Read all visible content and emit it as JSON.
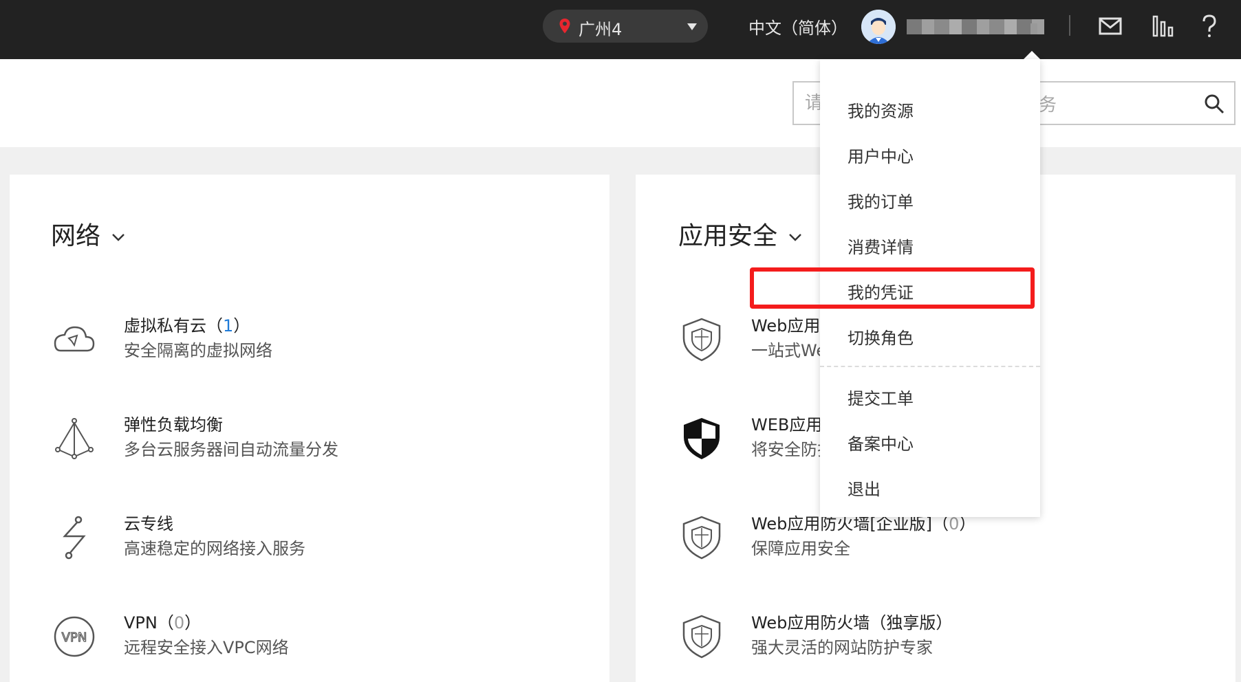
{
  "topbar": {
    "region": "广州4",
    "language": "中文（简体）"
  },
  "search": {
    "placeholder": "请",
    "placeholder_tail": "务"
  },
  "left_panel": {
    "title": "网络",
    "services": [
      {
        "name": "虚拟私有云",
        "count": "1",
        "desc": "安全隔离的虚拟网络"
      },
      {
        "name": "弹性负载均衡",
        "desc": "多台云服务器间自动流量分发"
      },
      {
        "name": "云专线",
        "desc": "高速稳定的网络接入服务"
      },
      {
        "name": "VPN",
        "count": "0",
        "desc": "远程安全接入VPC网络"
      }
    ]
  },
  "right_panel": {
    "title": "应用安全",
    "services": [
      {
        "name": "Web应用",
        "desc": "一站式We"
      },
      {
        "name": "WEB应用",
        "desc": "将安全防护"
      },
      {
        "name": "Web应用防火墙[企业版]",
        "count": "0",
        "desc": "保障应用安全"
      },
      {
        "name": "Web应用防火墙（独享版）",
        "desc": "强大灵活的网站防护专家"
      }
    ]
  },
  "user_menu": {
    "items": [
      "我的资源",
      "用户中心",
      "我的订单",
      "消费详情",
      "我的凭证",
      "切换角色"
    ],
    "items2": [
      "提交工单",
      "备案中心",
      "退出"
    ]
  },
  "colors": {
    "topbar": "#222222",
    "highlight": "#f41c1c",
    "count_active": "#1f7bd8"
  }
}
